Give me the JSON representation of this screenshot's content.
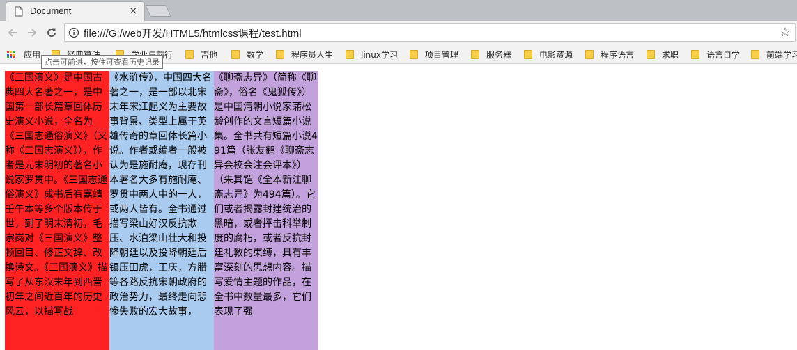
{
  "tab": {
    "title": "Document",
    "close_glyph": "×"
  },
  "toolbar": {
    "back_icon": "arrow-left-icon",
    "forward_icon": "arrow-right-icon",
    "reload_icon": "reload-icon",
    "url": "file:///G:/web开发/HTML5/htmlcss课程/test.html",
    "star_glyph": "☆"
  },
  "tooltip": "点击可前进，按住可查看历史记录",
  "bookmarks": {
    "apps": "应用",
    "items": [
      "经典算法",
      "学业与前行",
      "吉他",
      "数学",
      "程序员人生",
      "linux学习",
      "项目管理",
      "服务器",
      "电影资源",
      "程序语言",
      "求职",
      "语言自学",
      "前端学习"
    ]
  },
  "columns": [
    "《三国演义》是中国古典四大名著之一，是中国第一部长篇章回体历史演义小说，全名为《三国志通俗演义》（又称《三国志演义》），作者是元末明初的著名小说家罗贯中。《三国志通俗演义》成书后有嘉靖壬午本等多个版本传于世，到了明末清初，毛宗岗对《三国演义》整顿回目、修正文辞、改换诗文。《三国演义》描写了从东汉末年到西晋初年之间近百年的历史风云，以描写战",
    "《水浒传》，中国四大名著之一，是一部以北宋末年宋江起义为主要故事背景、类型上属于英雄传奇的章回体长篇小说。作者或编者一般被认为是施耐庵，现存刊本署名大多有施耐庵、罗贯中两人中的一人，或两人皆有。全书通过描写梁山好汉反抗欺压、水泊梁山壮大和投降朝廷以及投降朝廷后镇压田虎，王庆，方腊等各路反抗宋朝政府的政治势力，最终走向悲惨失败的宏大故事，",
    "《聊斋志异》（简称《聊斋》，俗名《鬼狐传》）是中国清朝小说家蒲松龄创作的文言短篇小说集。全书共有短篇小说491篇（张友鹤《聊斋志异会校会注会评本》）（朱其铠《全本新注聊斋志异》为494篇）。它们或者揭露封建统治的黑暗，或者抨击科举制度的腐朽，或者反抗封建礼教的束缚，具有丰富深刻的思想内容。描写爱情主题的作品，在全书中数量最多，它们表现了强"
  ],
  "colors": {
    "col1": "#ff2222",
    "col2": "#a9cbef",
    "col3": "#c3a1dc"
  }
}
